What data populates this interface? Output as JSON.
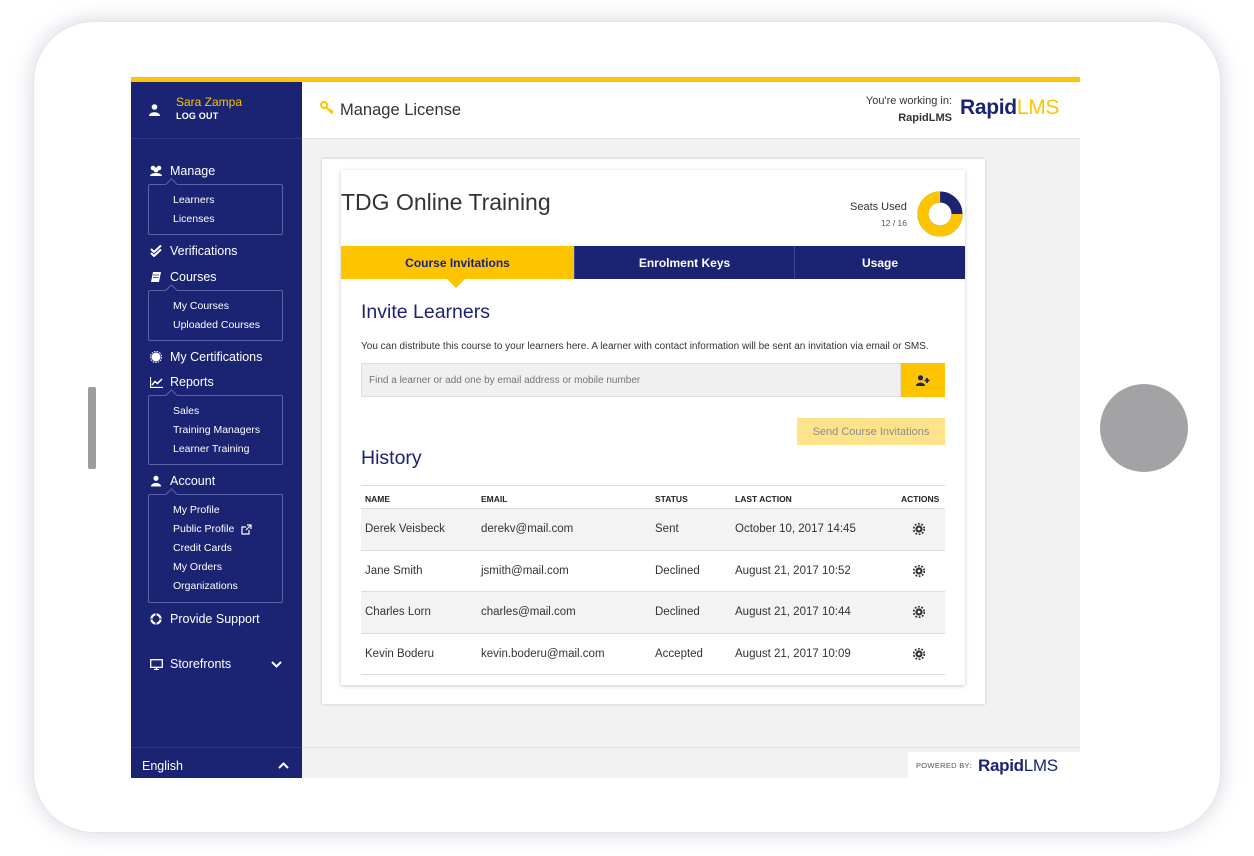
{
  "user": {
    "name": "Sara Zampa",
    "logout_label": "LOG OUT"
  },
  "header": {
    "title": "Manage License",
    "working_in_label": "You're working in:",
    "working_in_value": "RapidLMS",
    "logo_main": "Rapid",
    "logo_accent": "LMS"
  },
  "sidebar": {
    "manage": {
      "label": "Manage",
      "items": [
        "Learners",
        "Licenses"
      ]
    },
    "verifications": {
      "label": "Verifications"
    },
    "courses": {
      "label": "Courses",
      "items": [
        "My Courses",
        "Uploaded Courses"
      ]
    },
    "certifications": {
      "label": "My Certifications"
    },
    "reports": {
      "label": "Reports",
      "items": [
        "Sales",
        "Training Managers",
        "Learner Training"
      ]
    },
    "account": {
      "label": "Account",
      "items": [
        "My Profile",
        "Public Profile",
        "Credit Cards",
        "My Orders",
        "Organizations"
      ]
    },
    "support": {
      "label": "Provide Support"
    },
    "storefronts": {
      "label": "Storefronts"
    },
    "language": "English"
  },
  "card": {
    "title": "TDG Online Training",
    "seats_label": "Seats Used",
    "seats_count": "12 / 16",
    "seats_used": 12,
    "seats_total": 16
  },
  "tabs": [
    {
      "label": "Course Invitations",
      "active": true
    },
    {
      "label": "Enrolment Keys",
      "active": false
    },
    {
      "label": "Usage",
      "active": false
    }
  ],
  "invite": {
    "title": "Invite Learners",
    "description": "You can distribute this course to your learners here. A learner with contact information will be sent an invitation via email or SMS.",
    "search_placeholder": "Find a learner or add one by email address or mobile number",
    "send_label": "Send Course Invitations"
  },
  "history": {
    "title": "History",
    "columns": [
      "NAME",
      "EMAIL",
      "STATUS",
      "LAST ACTION",
      "ACTIONS"
    ],
    "rows": [
      {
        "name": "Derek Veisbeck",
        "email": "derekv@mail.com",
        "status": "Sent",
        "last_action": "October 10, 2017 14:45"
      },
      {
        "name": "Jane Smith",
        "email": "jsmith@mail.com",
        "status": "Declined",
        "last_action": "August 21, 2017 10:52"
      },
      {
        "name": "Charles Lorn",
        "email": "charles@mail.com",
        "status": "Declined",
        "last_action": "August 21, 2017 10:44"
      },
      {
        "name": "Kevin Boderu",
        "email": "kevin.boderu@mail.com",
        "status": "Accepted",
        "last_action": "August 21, 2017 10:09"
      }
    ]
  },
  "footer": {
    "powered_by": "POWERED BY:",
    "logo_main": "Rapid",
    "logo_accent": "LMS"
  },
  "colors": {
    "navy": "#1b2373",
    "yellow": "#ffc400",
    "light_yellow": "#ffe38a"
  }
}
